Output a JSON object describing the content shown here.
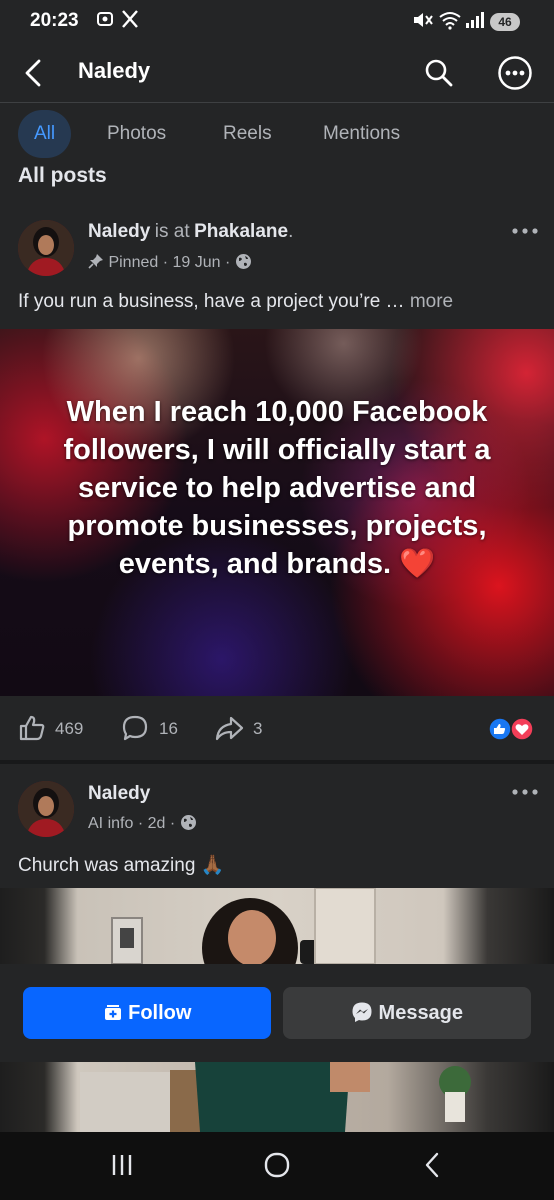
{
  "status_bar": {
    "time": "20:23",
    "battery": "46",
    "icons": [
      "screenshot-icon",
      "x-app-icon",
      "mute-icon",
      "wifi-icon",
      "signal-icon",
      "battery-icon"
    ]
  },
  "header": {
    "title": "Naledy",
    "icons": [
      "back-arrow-icon",
      "search-icon",
      "more-options-icon"
    ]
  },
  "tabs": [
    {
      "label": "All",
      "active": true
    },
    {
      "label": "Photos",
      "active": false
    },
    {
      "label": "Reels",
      "active": false
    },
    {
      "label": "Mentions",
      "active": false
    }
  ],
  "section_title": "All posts",
  "posts": [
    {
      "author": "Naledy",
      "checkin_prefix": "is at",
      "location": "Phakalane",
      "pinned_label": "Pinned",
      "date": "19 Jun",
      "text": "If you run a business, have a project you’re …",
      "more_label": "more",
      "image_text": "When I reach 10,000 Facebook followers, I will officially start a service to help advertise and promote businesses, projects, events, and brands.",
      "image_emoji": "❤️",
      "likes": "469",
      "comments": "16",
      "shares": "3",
      "reaction_icons": [
        "like-reaction-icon",
        "love-reaction-icon"
      ]
    },
    {
      "author": "Naledy",
      "ai_info": "AI info",
      "date": "2d",
      "text": "Church was amazing",
      "text_emoji": "🙏🏾"
    }
  ],
  "actions": {
    "follow_label": "Follow",
    "message_label": "Message"
  },
  "colors": {
    "background": "#242526",
    "accent": "#0866ff",
    "active_tab_bg": "#263951",
    "active_tab_text": "#4599ff"
  }
}
